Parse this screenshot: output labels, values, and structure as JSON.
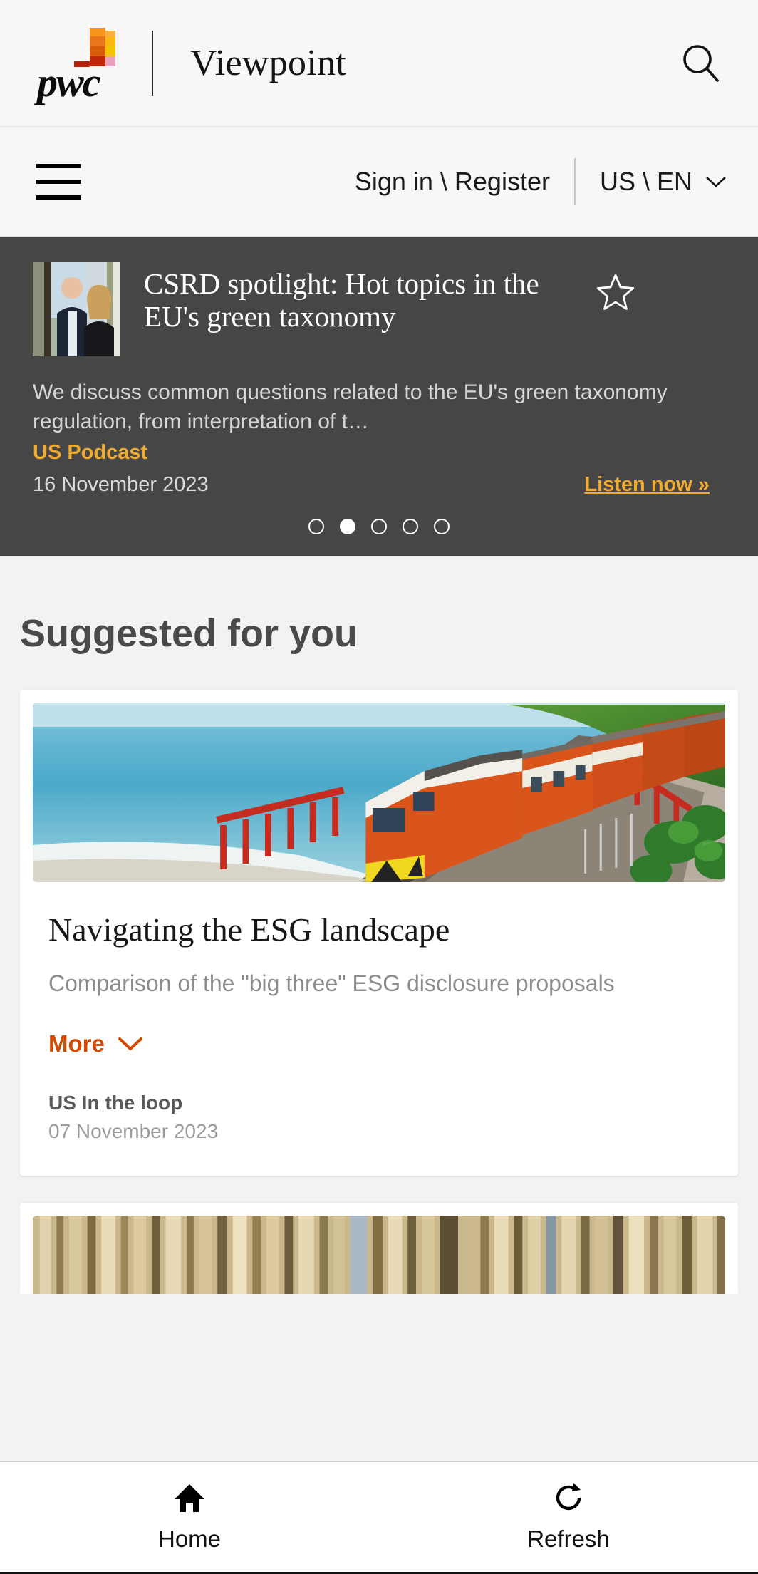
{
  "header": {
    "logo_alt": "pwc",
    "logo_wordmark": "pwc",
    "product_title": "Viewpoint",
    "search_icon": "search-icon"
  },
  "nav": {
    "menu_icon": "hamburger-menu-icon",
    "signin_label": "Sign in \\ Register",
    "locale_label": "US \\ EN",
    "locale_chevron": "chevron-down-icon"
  },
  "hero": {
    "title": "CSRD spotlight: Hot topics in the EU's green taxonomy",
    "description": "We discuss common questions related to the EU's green taxonomy regulation, from interpretation of t…",
    "category": "US Podcast",
    "date": "16 November 2023",
    "cta_label": "Listen now »",
    "bookmark_icon": "star-outline-icon",
    "thumbnail_alt": "two-presenters-photo",
    "dots_total": 5,
    "dots_active_index": 1,
    "background_color": "#464646",
    "accent_color": "#f0ab30"
  },
  "suggested": {
    "title": "Suggested for you",
    "cards": [
      {
        "image_alt": "coastal-train-photo",
        "title": "Navigating the ESG landscape",
        "subtitle": "Comparison of the \"big three\" ESG disclosure proposals",
        "more_label": "More",
        "more_chevron": "chevron-down-icon",
        "category": "US In the loop",
        "date": "07 November 2023",
        "accent_color": "#d04a02"
      },
      {
        "image_alt": "bamboo-texture-photo"
      }
    ]
  },
  "bottom_bar": {
    "items": [
      {
        "icon": "home-icon",
        "label": "Home"
      },
      {
        "icon": "refresh-icon",
        "label": "Refresh"
      }
    ]
  }
}
